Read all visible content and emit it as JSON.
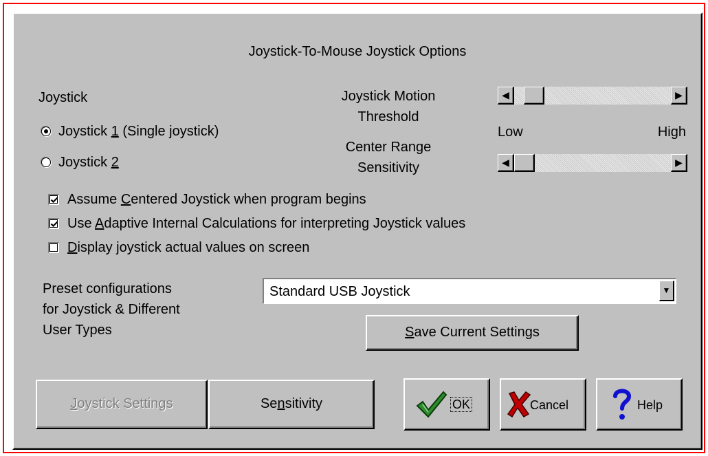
{
  "dialog": {
    "title": "Joystick-To-Mouse Joystick Options"
  },
  "joystick_group": {
    "label": "Joystick",
    "option1": {
      "before": "Joystick ",
      "mnemonic": "1",
      "after": " (Single joystick)",
      "selected": true
    },
    "option2": {
      "before": "Joystick ",
      "mnemonic": "2",
      "after": "",
      "selected": false
    }
  },
  "motion_threshold": {
    "label_line1": "Joystick Motion",
    "label_line2": "Threshold",
    "low_label": "Low",
    "high_label": "High",
    "value": 0.07
  },
  "center_range": {
    "label_line1": "Center Range",
    "label_line2": "Sensitivity",
    "value": 0.0
  },
  "checkboxes": {
    "assume_centered": {
      "before": "Assume ",
      "mnemonic": "C",
      "after": "entered Joystick when program begins",
      "checked": true
    },
    "adaptive": {
      "before": "Use ",
      "mnemonic": "A",
      "after": "daptive Internal Calculations for interpreting Joystick values",
      "checked": true
    },
    "display_values": {
      "before": "",
      "mnemonic": "D",
      "after": "isplay joystick actual values on screen",
      "checked": false
    }
  },
  "preset": {
    "label_line1": "Preset configurations",
    "label_line2": "for Joystick & Different",
    "label_line3": "User Types",
    "selected": "Standard USB Joystick"
  },
  "buttons": {
    "save": {
      "mnemonic": "S",
      "after": "ave Current Settings"
    },
    "joystick_settings": {
      "mnemonic": "J",
      "after": "oystick Settings",
      "enabled": false
    },
    "sensitivity": {
      "before": "Se",
      "mnemonic": "n",
      "after": "sitivity"
    },
    "ok": {
      "label": "OK",
      "icon": "checkmark-icon"
    },
    "cancel": {
      "label": "Cancel",
      "icon": "x-icon"
    },
    "help": {
      "label": "Help",
      "icon": "question-mark-icon"
    }
  },
  "colors": {
    "face": "#c0c0c0",
    "frame_border": "#ff0000",
    "ok_icon": "#2e8b2e",
    "cancel_icon": "#c00000",
    "help_icon": "#1010d0"
  }
}
